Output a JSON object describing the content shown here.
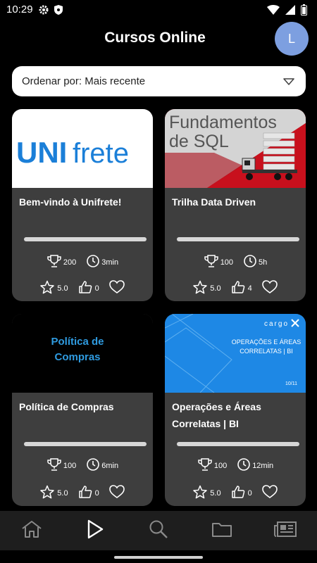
{
  "status_bar": {
    "time": "10:29"
  },
  "header": {
    "title": "Cursos Online",
    "avatar_initial": "L"
  },
  "sort": {
    "label": "Ordenar por: Mais recente"
  },
  "courses": [
    {
      "title": "Bem-vindo à Unifrete!",
      "image_text_a": "UNI",
      "image_text_b": "frete",
      "points": "200",
      "duration": "3min",
      "rating": "5.0",
      "likes": "0",
      "progress": 0
    },
    {
      "title": "Trilha Data Driven",
      "image_text_a": "Fundamentos",
      "image_text_b": "de SQL",
      "points": "100",
      "duration": "5h",
      "rating": "5.0",
      "likes": "4",
      "progress": 0
    },
    {
      "title": "Política de Compras",
      "image_text_a": "Política de",
      "image_text_b": "Compras",
      "points": "100",
      "duration": "6min",
      "rating": "5.0",
      "likes": "0",
      "progress": 0
    },
    {
      "title": "Operações e Áreas Correlatas | BI",
      "image_text_a": "cargo",
      "image_text_b": "OPERAÇÕES E ÁREAS CORRELATAS | BI",
      "image_text_c": "10/11",
      "points": "100",
      "duration": "12min",
      "rating": "5.0",
      "likes": "0",
      "progress": 0
    }
  ],
  "nav": [
    "home-icon",
    "play-icon",
    "search-icon",
    "folder-icon",
    "news-icon"
  ],
  "colors": {
    "accent": "#7d9fe0",
    "card": "#3e3e3e",
    "unifrete_blue": "#1b7fd8",
    "sql_red": "#c8101d",
    "politica_blue": "#2f9be0",
    "cargo_blue": "#1e88e5"
  }
}
